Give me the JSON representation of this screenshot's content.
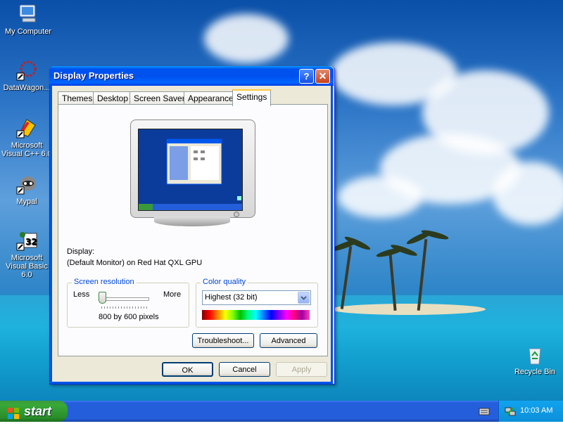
{
  "desktop": {
    "icons": [
      {
        "label": "My Computer"
      },
      {
        "label": "DataWagon..."
      },
      {
        "label": "Microsoft Visual C++ 6.0"
      },
      {
        "label": "Mypal"
      },
      {
        "label": "Microsoft Visual Basic 6.0"
      },
      {
        "label": "Recycle Bin"
      }
    ]
  },
  "window": {
    "title": "Display Properties",
    "help_glyph": "?",
    "close_glyph": "✕",
    "tabs": [
      "Themes",
      "Desktop",
      "Screen Saver",
      "Appearance",
      "Settings"
    ],
    "active_tab": "Settings",
    "display_label": "Display:",
    "display_value": "(Default Monitor) on Red Hat QXL GPU",
    "screen_resolution": {
      "legend": "Screen resolution",
      "less": "Less",
      "more": "More",
      "value_text": "800 by 600 pixels",
      "slider_level": 0
    },
    "color_quality": {
      "legend": "Color quality",
      "selected": "Highest (32 bit)"
    },
    "buttons": {
      "troubleshoot": "Troubleshoot...",
      "advanced": "Advanced",
      "ok": "OK",
      "cancel": "Cancel",
      "apply": "Apply"
    }
  },
  "taskbar": {
    "start_label": "start",
    "clock": "10:03 AM"
  },
  "colors": {
    "titlebar": "#0055e5",
    "tab_highlight": "#ffc83c",
    "group_legend": "#0046d5",
    "taskbar": "#245edb",
    "start": "#2a8e2a"
  }
}
